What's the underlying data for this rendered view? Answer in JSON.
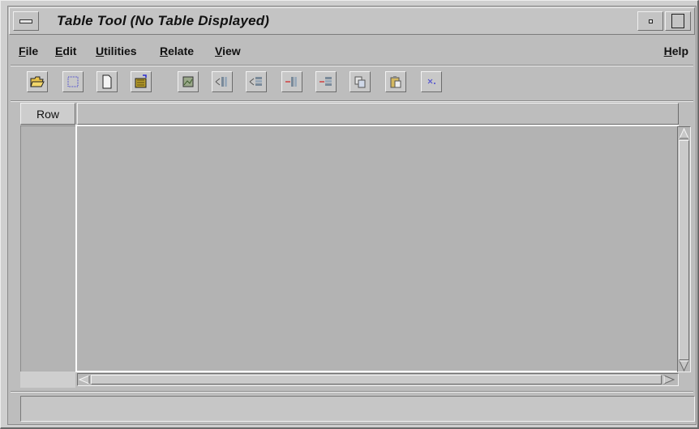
{
  "window": {
    "title": "Table Tool (No Table Displayed)"
  },
  "menubar": {
    "items": [
      {
        "label": "File",
        "mnemonic": "F"
      },
      {
        "label": "Edit",
        "mnemonic": "E"
      },
      {
        "label": "Utilities",
        "mnemonic": "U"
      },
      {
        "label": "Relate",
        "mnemonic": "R"
      },
      {
        "label": "View",
        "mnemonic": "V"
      }
    ],
    "help": {
      "label": "Help",
      "mnemonic": "H"
    }
  },
  "toolbar": {
    "buttons": [
      {
        "icon": "open-folder-icon"
      },
      {
        "icon": "select-frame-icon"
      },
      {
        "icon": "new-document-icon"
      },
      {
        "icon": "open-table-icon"
      },
      {
        "icon": "image-table-icon"
      },
      {
        "icon": "insert-column-icon"
      },
      {
        "icon": "insert-row-icon"
      },
      {
        "icon": "delete-column-icon"
      },
      {
        "icon": "delete-row-icon"
      },
      {
        "icon": "copy-icon"
      },
      {
        "icon": "paste-icon"
      },
      {
        "icon": "clear-selection-icon"
      }
    ]
  },
  "table": {
    "row_header": "Row"
  },
  "status": {
    "text": ""
  },
  "colors": {
    "window_bg": "#cfcfcf",
    "table_bg": "#b3b3b3",
    "accent_red": "#d04040"
  }
}
